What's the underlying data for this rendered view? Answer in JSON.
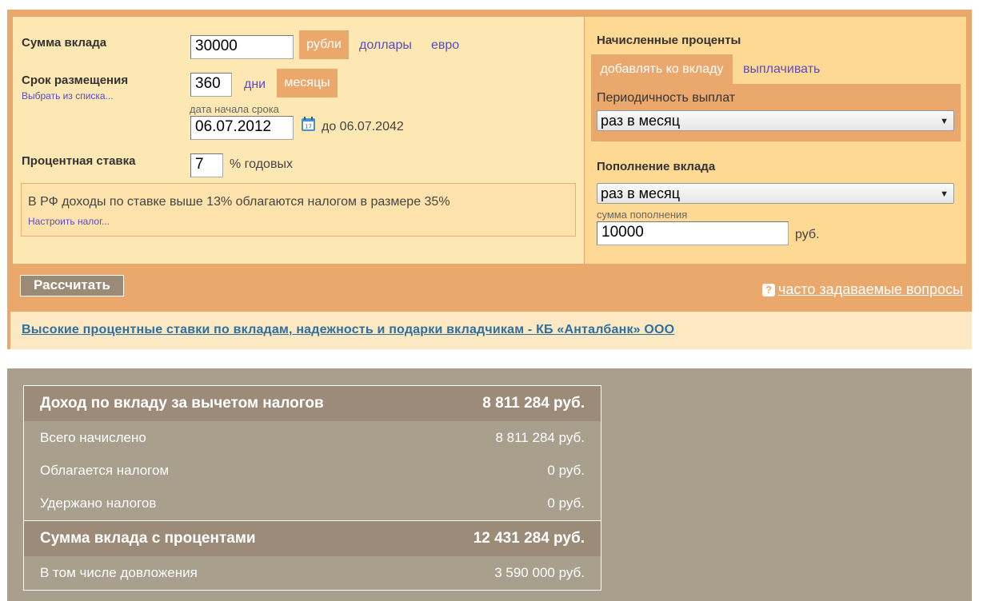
{
  "deposit": {
    "amount_label": "Сумма вклада",
    "amount_value": "30000",
    "currencies": [
      "рубли",
      "доллары",
      "евро"
    ]
  },
  "term": {
    "label": "Срок размещения",
    "choose_link": "Выбрать из списка...",
    "value": "360",
    "units": [
      "дни",
      "месяцы"
    ],
    "start_label": "дата начала срока",
    "start_date": "06.07.2012",
    "end_text": "до 06.07.2042"
  },
  "rate": {
    "label": "Процентная ставка",
    "value": "7",
    "unit": "% годовых"
  },
  "tax": {
    "note": "В РФ доходы по ставке выше 13% облагаются налогом в размере 35%",
    "configure_link": "Настроить налог..."
  },
  "accrued": {
    "title": "Начисленные проценты",
    "options": [
      "добавлять ко вкладу",
      "выплачивать"
    ],
    "period_label": "Периодичность выплат",
    "period_value": "раз в месяц"
  },
  "replenish": {
    "title": "Пополнение вклада",
    "frequency": "раз в месяц",
    "amount_label": "сумма пополнения",
    "amount_value": "10000",
    "amount_unit": "руб."
  },
  "actions": {
    "calculate": "Рассчитать",
    "faq": "часто задаваемые вопросы",
    "faq_icon": "?"
  },
  "ad": {
    "text": "Высокие процентные ставки по вкладам, надежность и подарки вкладчикам - КБ «Анталбанк» ООО"
  },
  "results": {
    "net_income_label": "Доход по вкладу за вычетом налогов",
    "net_income_value": "8 811 284 руб.",
    "total_accrued_label": "Всего начислено",
    "total_accrued_value": "8 811 284 руб.",
    "taxable_label": "Облагается налогом",
    "taxable_value": "0 руб.",
    "withheld_label": "Удержано налогов",
    "withheld_value": "0 руб.",
    "total_sum_label": "Сумма вклада с процентами",
    "total_sum_value": "12 431 284 руб.",
    "deposits_label": "В том числе довложения",
    "deposits_value": "3 590 000 руб."
  },
  "colors": {
    "accent": "#eaa86c",
    "left_panel": "#fde8b3",
    "right_panel": "#fdd993",
    "link": "#5a4bc0",
    "results_bg": "#a89f8d",
    "results_header": "#9b8b78"
  }
}
